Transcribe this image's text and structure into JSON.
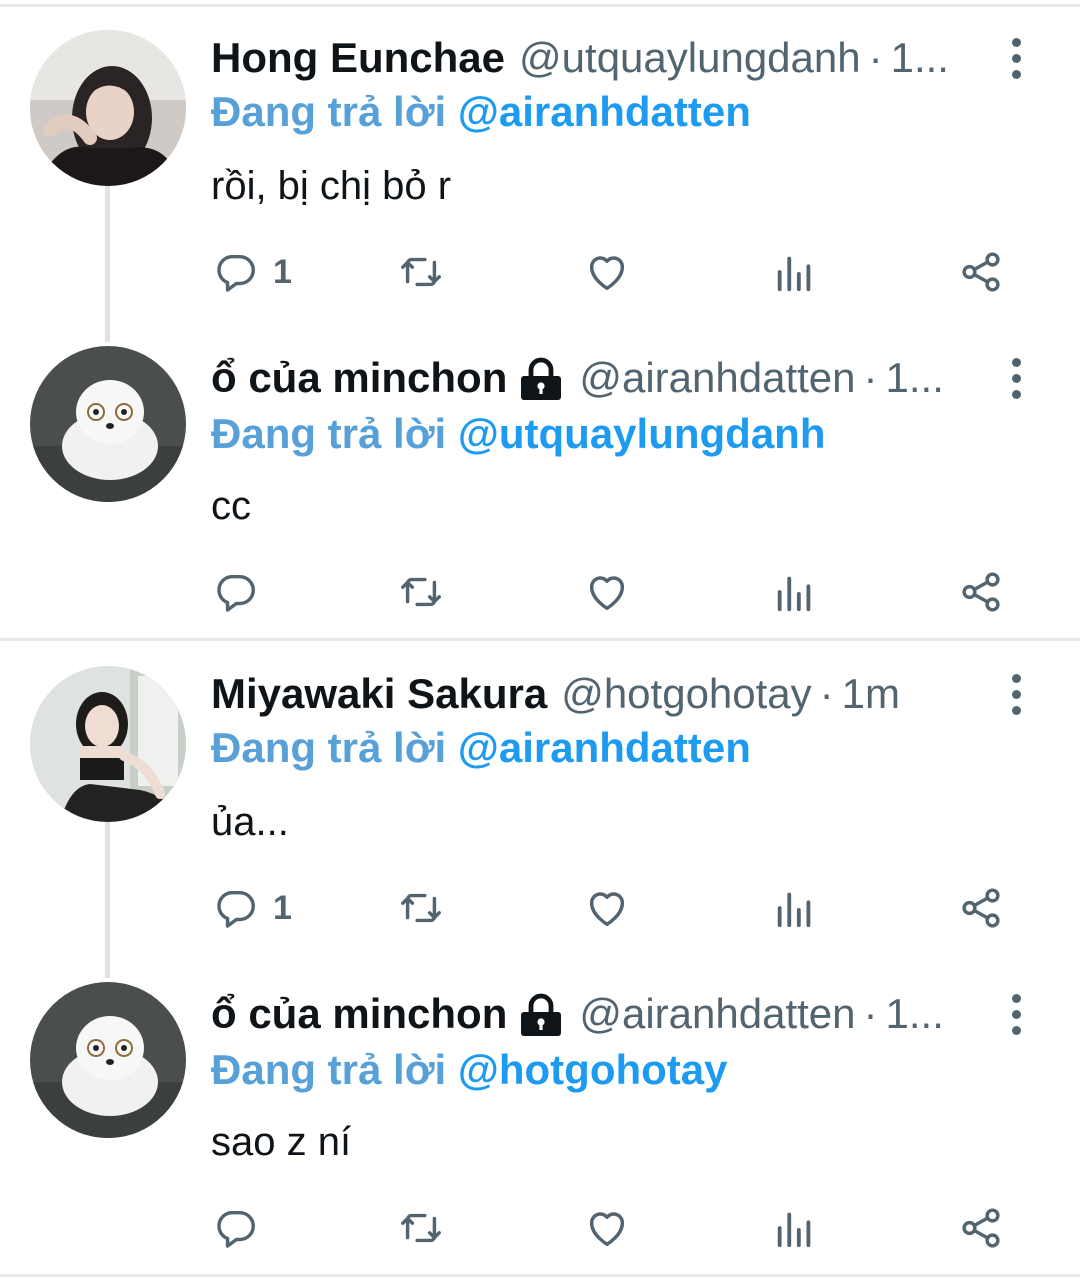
{
  "tweets": [
    {
      "name": "Hong Eunchae",
      "locked": false,
      "handle": "@utquaylungdanh",
      "dot": "·",
      "time": "1...",
      "replying_prefix": "Đang trả lời",
      "replying_to": "@airanhdatten",
      "text": "rồi, bị chị bỏ r",
      "reply_count": "1",
      "avatar": "woman-portrait"
    },
    {
      "name": "ổ của minchon",
      "locked": true,
      "handle": "@airanhdatten",
      "dot": "·",
      "time": "1...",
      "replying_prefix": "Đang trả lời",
      "replying_to": "@utquaylungdanh",
      "text": "cc",
      "reply_count": "",
      "avatar": "white-pomeranian-dog"
    },
    {
      "name": "Miyawaki Sakura",
      "locked": false,
      "handle": "@hotgohotay",
      "dot": "·",
      "time": "1m",
      "replying_prefix": "Đang trả lời",
      "replying_to": "@airanhdatten",
      "text": "ủa...",
      "reply_count": "1",
      "avatar": "woman-mirror-selfie"
    },
    {
      "name": "ổ của minchon",
      "locked": true,
      "handle": "@airanhdatten",
      "dot": "·",
      "time": "1...",
      "replying_prefix": "Đang trả lời",
      "replying_to": "@hotgohotay",
      "text": "sao z ní",
      "reply_count": "",
      "avatar": "white-pomeranian-dog"
    }
  ],
  "icons": {
    "reply": "reply-icon",
    "retweet": "retweet-icon",
    "like": "like-icon",
    "views": "views-icon",
    "share": "share-icon",
    "more": "more-options-icon",
    "lock": "lock-icon"
  },
  "colors": {
    "mention": "#1d9bf0",
    "replying_label": "#57a0d8",
    "secondary_text": "#536471",
    "divider": "#e6e9ec"
  }
}
